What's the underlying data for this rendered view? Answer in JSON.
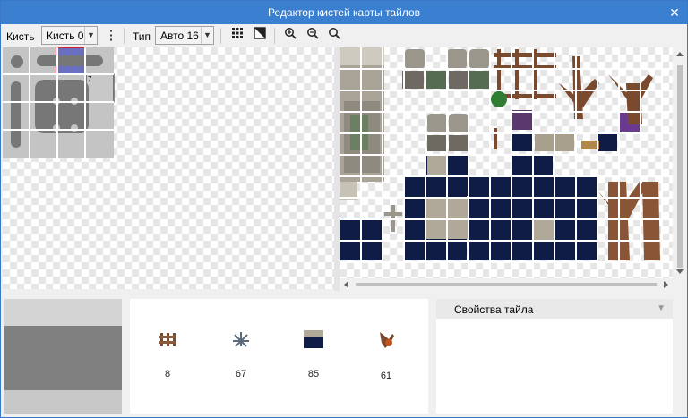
{
  "window": {
    "title": "Редактор кистей карты тайлов",
    "close_glyph": "✕"
  },
  "toolbar": {
    "brush_label": "Кисть",
    "brush_value": "Кисть 0",
    "type_label": "Тип",
    "type_value": "Авто 16",
    "more_glyph": "⋮",
    "grid_icon": "grid-icon",
    "fill_icon": "half-fill-icon",
    "zoom_in_icon": "zoom-in-icon",
    "zoom_out_icon": "zoom-out-icon",
    "zoom_reset_icon": "zoom-reset-icon"
  },
  "brush": {
    "selected_cell_number": "7"
  },
  "variations": [
    {
      "icon": "fence-tile-icon",
      "count": "8"
    },
    {
      "icon": "dead-grass-tile-icon",
      "count": "67"
    },
    {
      "icon": "dark-water-tile-icon",
      "count": "85"
    },
    {
      "icon": "dead-tree-tile-icon",
      "count": "61"
    }
  ],
  "properties": {
    "title": "Свойства тайла"
  },
  "colors": {
    "titlebar": "#3a7fd0",
    "selection": "#d02040",
    "water": "#0f1c45",
    "stone": "#b9b4a8",
    "wood": "#7a4a2f"
  }
}
